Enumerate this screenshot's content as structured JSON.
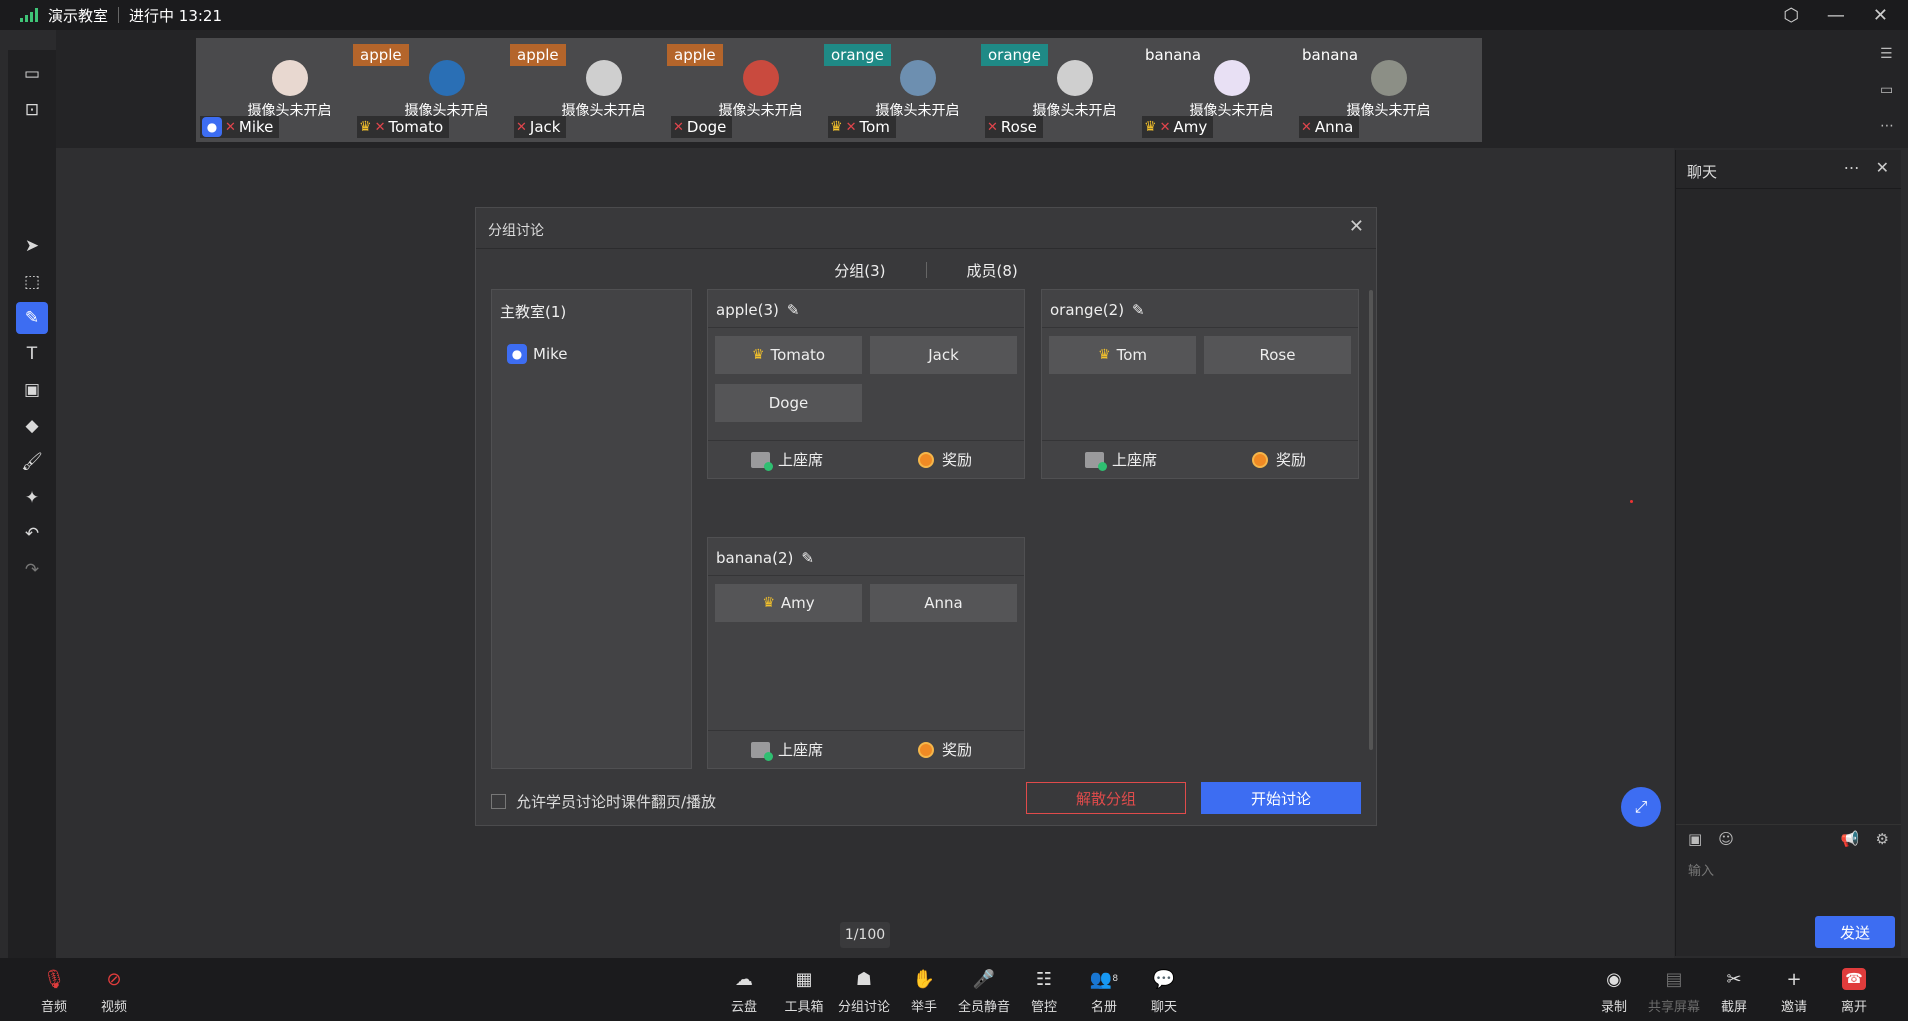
{
  "topbar": {
    "title": "演示教室",
    "status": "进行中 13:21"
  },
  "participants": [
    {
      "name": "Mike",
      "group": "",
      "tag_color": "",
      "camera_text": "摄像头未开启",
      "host": true,
      "leader": false
    },
    {
      "name": "Tomato",
      "group": "apple",
      "tag_color": "#b4652b",
      "camera_text": "摄像头未开启",
      "host": false,
      "leader": true
    },
    {
      "name": "Jack",
      "group": "apple",
      "tag_color": "#b4652b",
      "camera_text": "摄像头未开启",
      "host": false,
      "leader": false
    },
    {
      "name": "Doge",
      "group": "apple",
      "tag_color": "#b4652b",
      "camera_text": "摄像头未开启",
      "host": false,
      "leader": false
    },
    {
      "name": "Tom",
      "group": "orange",
      "tag_color": "#1f8a86",
      "camera_text": "摄像头未开启",
      "host": false,
      "leader": true
    },
    {
      "name": "Rose",
      "group": "orange",
      "tag_color": "#1f8a86",
      "camera_text": "摄像头未开启",
      "host": false,
      "leader": false
    },
    {
      "name": "Amy",
      "group": "banana",
      "tag_color": "#4a4a4c",
      "camera_text": "摄像头未开启",
      "host": false,
      "leader": true
    },
    {
      "name": "Anna",
      "group": "banana",
      "tag_color": "#4a4a4c",
      "camera_text": "摄像头未开启",
      "host": false,
      "leader": false
    }
  ],
  "dialog": {
    "title": "分组讨论",
    "tabs": [
      "分组(3)",
      "成员(8)"
    ],
    "main_room": {
      "title": "主教室(1)",
      "members": [
        "Mike"
      ]
    },
    "groups": [
      {
        "title": "apple(3)",
        "members": [
          {
            "name": "Tomato",
            "leader": true
          },
          {
            "name": "Jack",
            "leader": false
          },
          {
            "name": "Doge",
            "leader": false
          }
        ]
      },
      {
        "title": "orange(2)",
        "members": [
          {
            "name": "Tom",
            "leader": true
          },
          {
            "name": "Rose",
            "leader": false
          }
        ]
      },
      {
        "title": "banana(2)",
        "members": [
          {
            "name": "Amy",
            "leader": true
          },
          {
            "name": "Anna",
            "leader": false
          }
        ]
      }
    ],
    "footer_seat": "上座席",
    "footer_reward": "奖励",
    "allow_label": "允许学员讨论时课件翻页/播放",
    "dissolve_label": "解散分组",
    "start_label": "开始讨论"
  },
  "page_indicator": "1/100",
  "chat": {
    "title": "聊天",
    "input_placeholder": "输入",
    "send_label": "发送"
  },
  "bottombar": {
    "audio": "音频",
    "video": "视频",
    "cloud": "云盘",
    "toolbox": "工具箱",
    "breakout": "分组讨论",
    "hands": "举手",
    "mute_all": "全员静音",
    "control": "管控",
    "roster": "名册",
    "roster_count": "8",
    "chat": "聊天",
    "record": "录制",
    "share": "共享屏幕",
    "screenshot": "截屏",
    "invite": "邀请",
    "leave": "离开"
  },
  "colors": {
    "accent": "#3d6df2",
    "danger": "#e04b4b",
    "leader_crown": "#f4c22b"
  }
}
